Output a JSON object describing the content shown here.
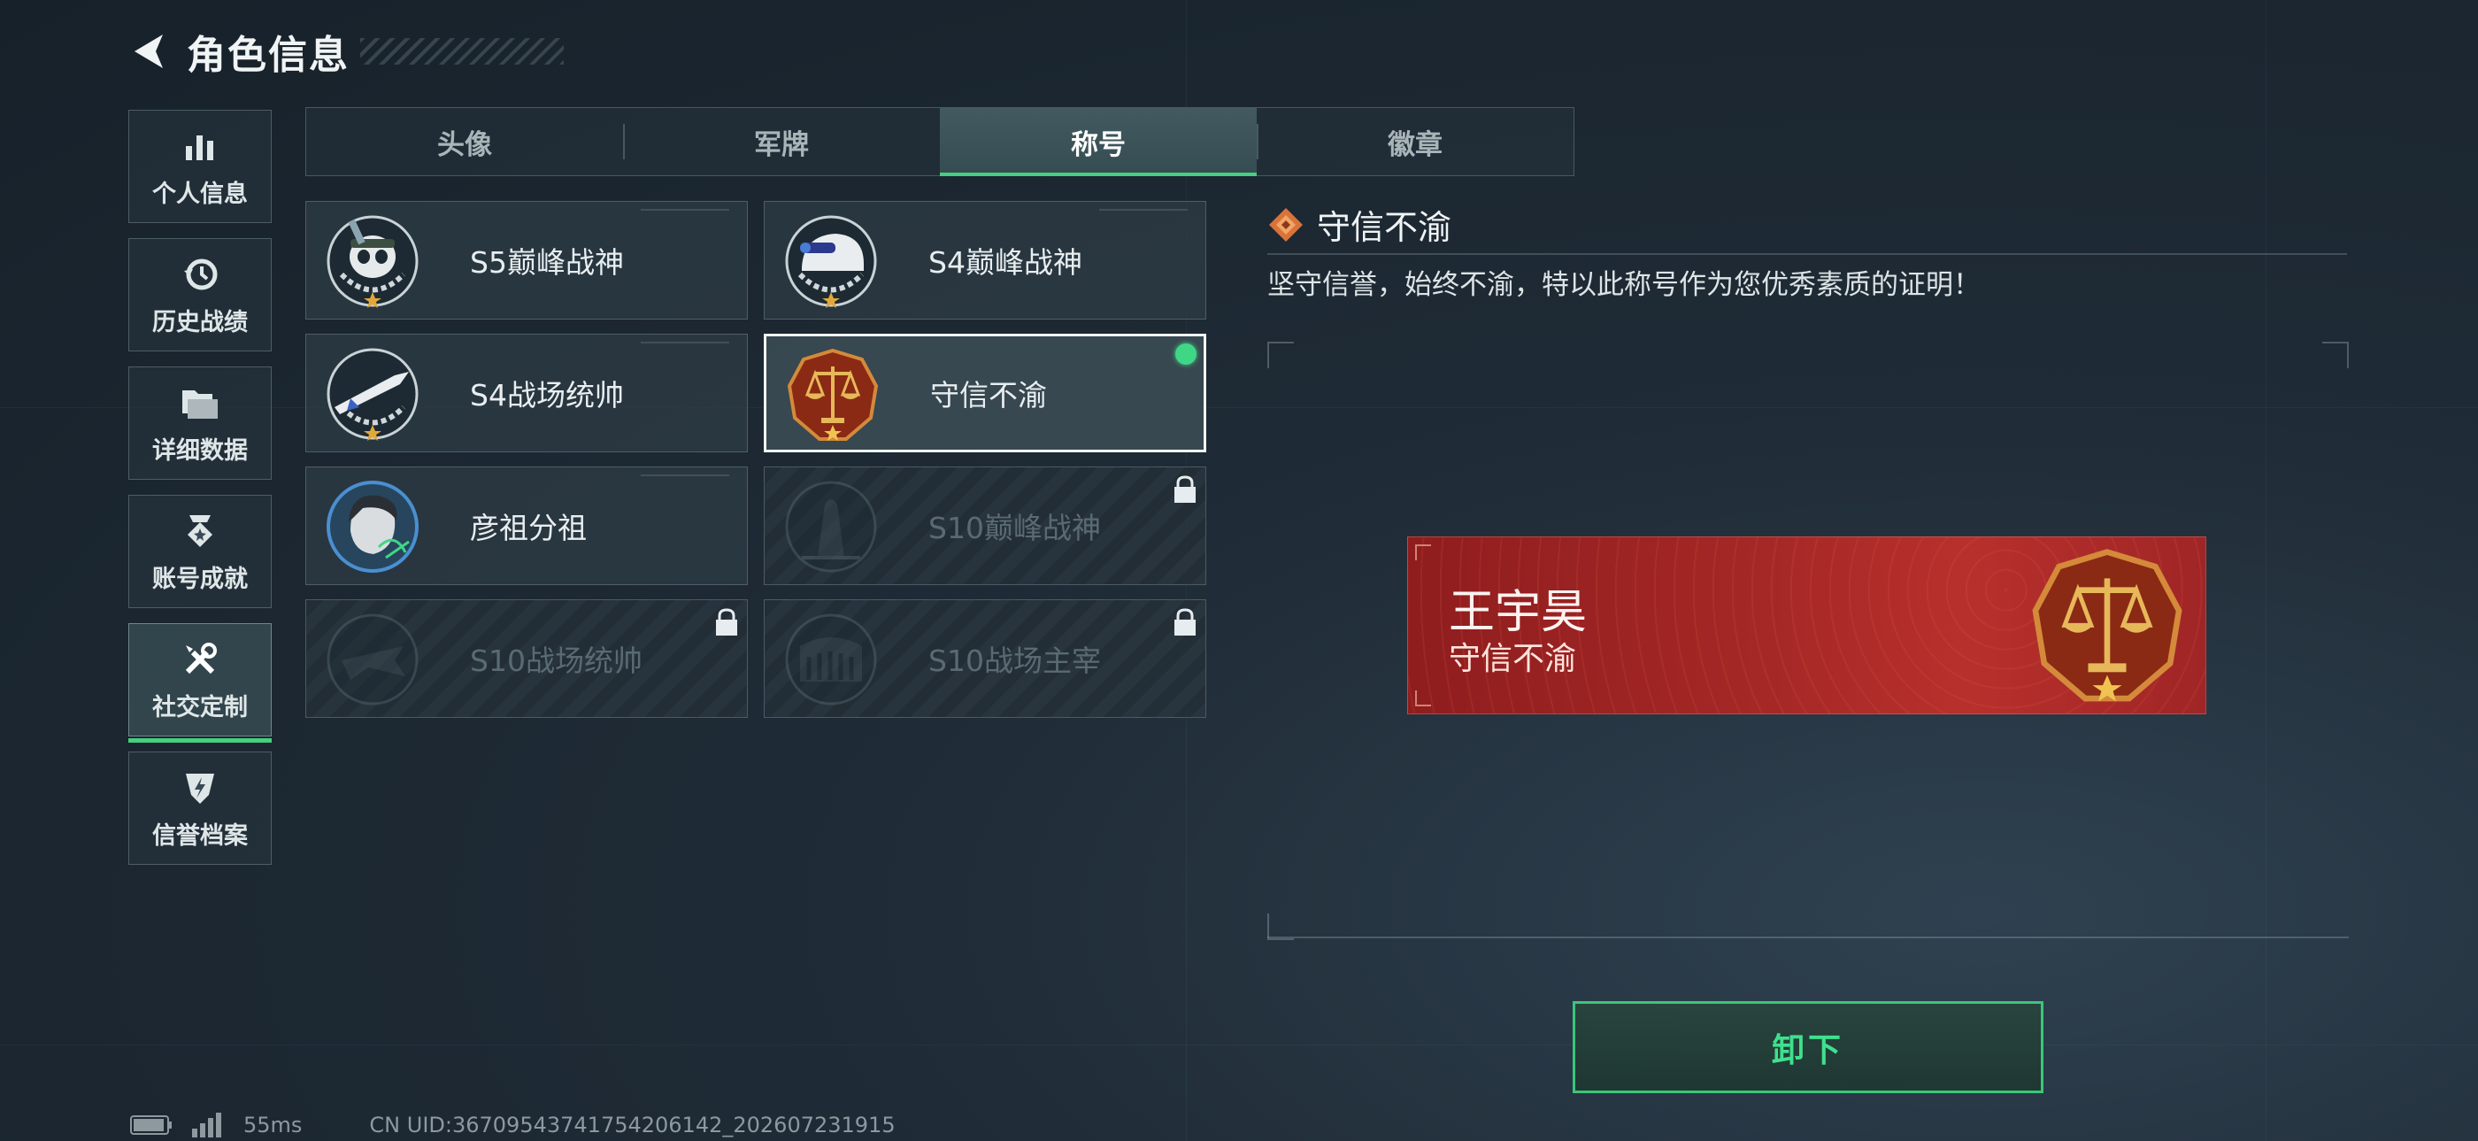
{
  "header": {
    "title": "角色信息"
  },
  "sidebar": {
    "items": [
      {
        "label": "个人信息",
        "icon": "bar-chart-icon"
      },
      {
        "label": "历史战绩",
        "icon": "history-clock-icon"
      },
      {
        "label": "详细数据",
        "icon": "folder-icon"
      },
      {
        "label": "账号成就",
        "icon": "achievement-medal-icon"
      },
      {
        "label": "社交定制",
        "icon": "tools-icon",
        "active": true
      },
      {
        "label": "信誉档案",
        "icon": "shield-lightning-icon"
      }
    ]
  },
  "tabs": [
    {
      "label": "头像"
    },
    {
      "label": "军牌"
    },
    {
      "label": "称号",
      "active": true
    },
    {
      "label": "徽章"
    }
  ],
  "titles": [
    {
      "label": "S5巅峰战神",
      "icon": "skull-emblem-icon",
      "locked": false
    },
    {
      "label": "S4巅峰战神",
      "icon": "helmet-emblem-icon",
      "locked": false
    },
    {
      "label": "S4战场统帅",
      "icon": "missile-emblem-icon",
      "locked": false
    },
    {
      "label": "守信不渝",
      "icon": "scales-emblem-icon",
      "locked": false,
      "selected": true,
      "equipped": true
    },
    {
      "label": "彦祖分祖",
      "icon": "portrait-emblem-icon",
      "locked": false
    },
    {
      "label": "S10巅峰战神",
      "icon": "tower-emblem-icon",
      "locked": true
    },
    {
      "label": "S10战场统帅",
      "icon": "jet-emblem-icon",
      "locked": true
    },
    {
      "label": "S10战场主宰",
      "icon": "colosseum-emblem-icon",
      "locked": true
    }
  ],
  "detail": {
    "title": "守信不渝",
    "description": "坚守信誉，始终不渝，特以此称号作为您优秀素质的证明！"
  },
  "preview": {
    "player_name": "王宇昊",
    "title": "守信不渝"
  },
  "actions": {
    "unequip_label": "卸下"
  },
  "status": {
    "ping": "55ms",
    "uid": "CN UID:3670954374175420614​2_202607231915"
  },
  "colors": {
    "accent_green": "#45d07f",
    "banner_red": "#a52826",
    "emblem_gold": "#d9a441"
  }
}
